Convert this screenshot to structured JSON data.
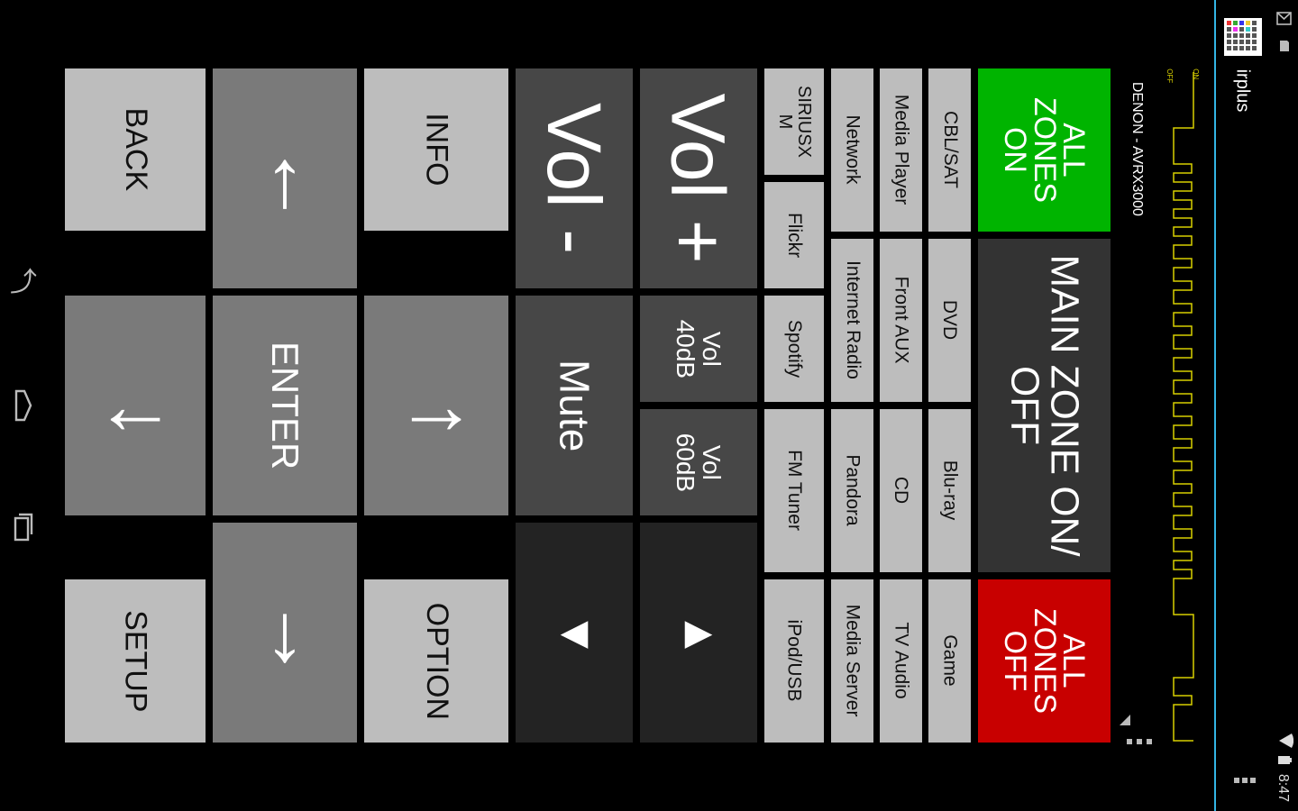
{
  "left_nav": {
    "back_icon": "android-back-icon",
    "home_icon": "android-home-icon",
    "recents_icon": "android-recents-icon"
  },
  "remote": {
    "back": "BACK",
    "info": "INFO",
    "setup": "SETUP",
    "option": "OPTION",
    "enter": "ENTER",
    "up_arrow": "↑",
    "down_arrow": "↓",
    "left_arrow": "←",
    "right_arrow": "→",
    "vol_plus": "Vol +",
    "vol_minus": "Vol -",
    "mute": "Mute",
    "vol_40": "Vol\n40dB",
    "vol_60": "Vol\n60dB",
    "play_left": "◀",
    "play_right": "▶"
  },
  "sources": {
    "siriusxm": "SIRIUSX\nM",
    "flickr": "Flickr",
    "spotify": "Spotify",
    "fm_tuner": "FM Tuner",
    "ipod_usb": "iPod/USB",
    "network": "Network",
    "internet_radio": "Internet Radio",
    "pandora": "Pandora",
    "media_server": "Media Server",
    "media_player": "Media Player",
    "front_aux": "Front AUX",
    "cd": "CD",
    "tv_audio": "TV Audio",
    "cbl_sat": "CBL/SAT",
    "dvd": "DVD",
    "bluray": "Blu-ray",
    "game": "Game"
  },
  "zones": {
    "all_on": "ALL\nZONES\nON",
    "main_toggle": "MAIN ZONE ON/\nOFF",
    "all_off": "ALL\nZONES\nOFF"
  },
  "device_label": "DENON - AVRX3000",
  "waveform": {
    "on_label": "ON",
    "off_label": "OFF"
  },
  "app_bar": {
    "title": "irplus"
  },
  "status_bar": {
    "time": "8:47"
  },
  "colors": {
    "zones_on": "#00b400",
    "zones_off": "#c80000",
    "waveform": "#d8d000",
    "accent_line": "#33b5e5"
  }
}
